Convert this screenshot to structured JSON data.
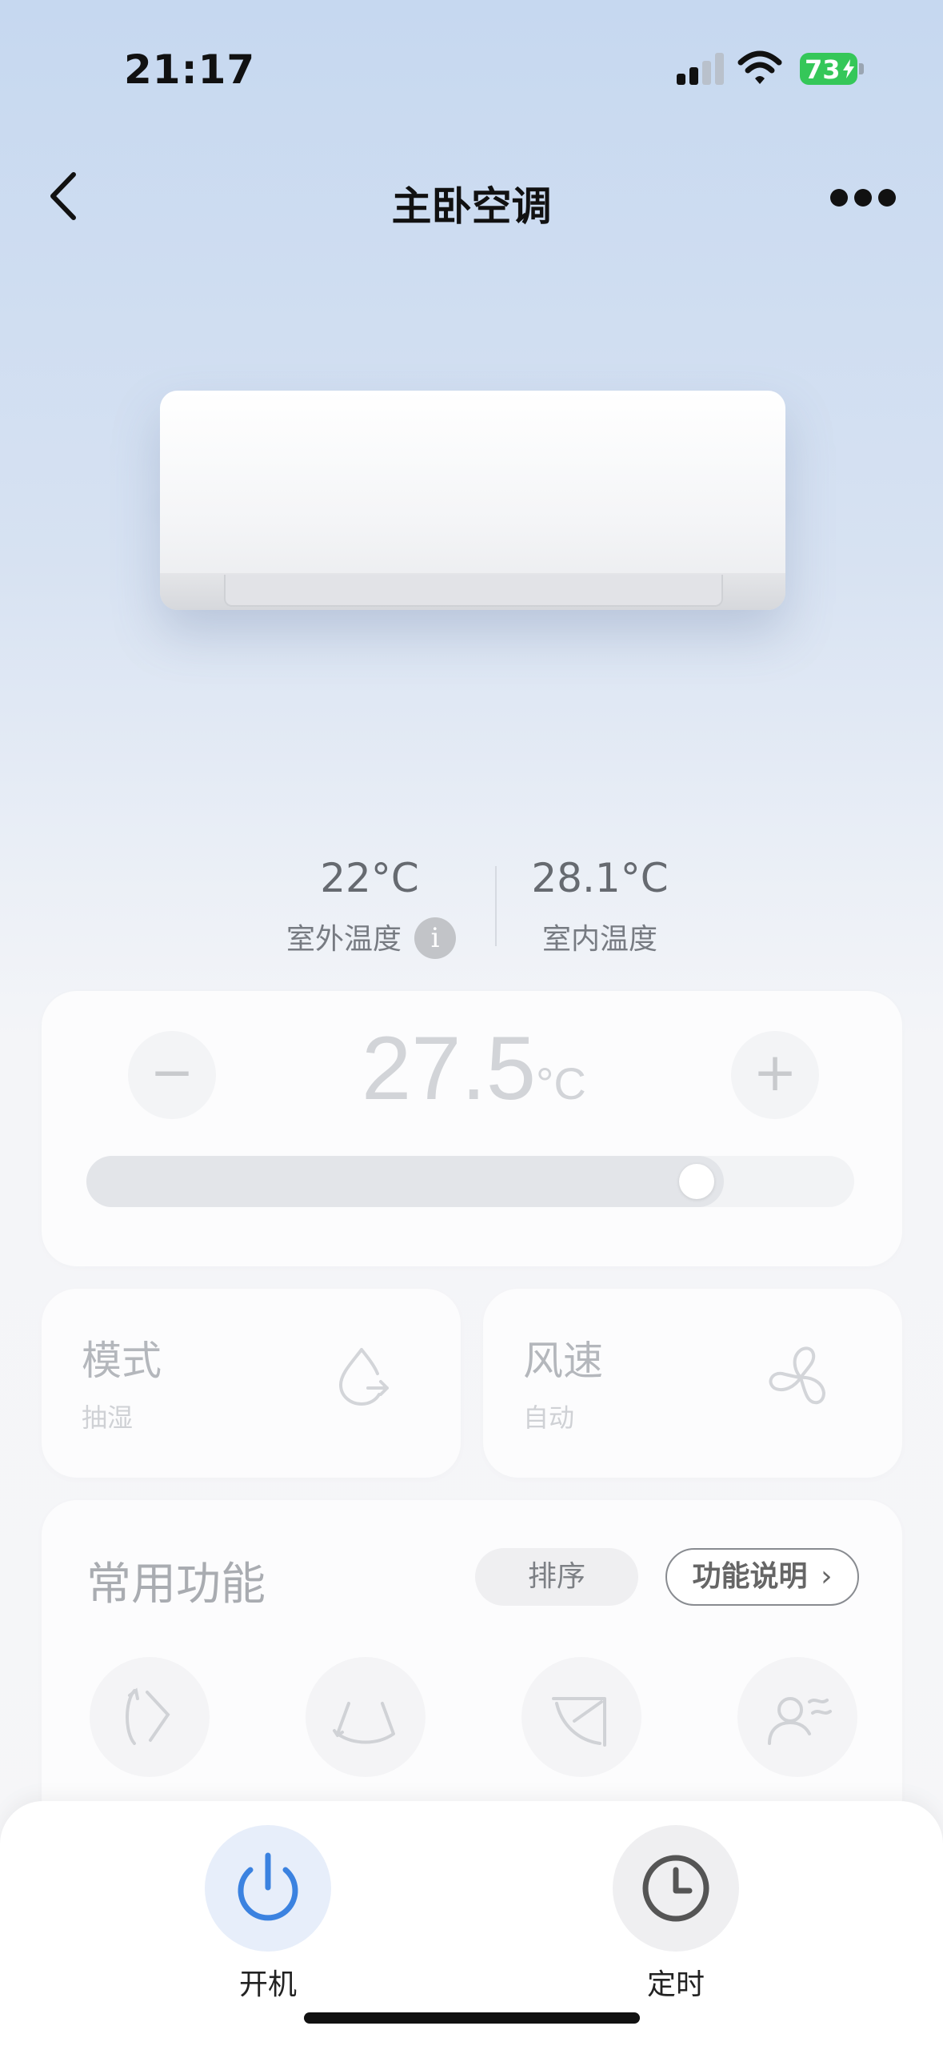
{
  "status_bar": {
    "time": "21:17",
    "battery_level": "73",
    "battery_color": "#35c759"
  },
  "nav": {
    "back_icon": "chevron-left-icon",
    "title": "主卧空调",
    "more_icon": "ellipsis-icon"
  },
  "temps": {
    "outdoor_value": "22°C",
    "outdoor_label": "室外温度",
    "info_icon_glyph": "i",
    "indoor_value": "28.1°C",
    "indoor_label": "室内温度"
  },
  "setpoint": {
    "minus_label": "−",
    "value": "27.5",
    "unit": "°C",
    "plus_label": "+",
    "slider_fraction": 0.83
  },
  "mode_card": {
    "title": "模式",
    "value": "抽湿",
    "icon": "droplet-icon"
  },
  "fan_card": {
    "title": "风速",
    "value": "自动",
    "icon": "fan-icon"
  },
  "functions": {
    "title": "常用功能",
    "sort_label": "排序",
    "desc_label": "功能说明",
    "desc_chevron": "›",
    "items": [
      {
        "icon": "swing-left-right-icon"
      },
      {
        "icon": "swing-up-down-icon"
      },
      {
        "icon": "swing-diagonal-icon"
      },
      {
        "icon": "person-wind-icon"
      }
    ]
  },
  "bottom_bar": {
    "power_label": "开机",
    "power_icon": "power-icon",
    "power_color": "#3b82e0",
    "timer_label": "定时",
    "timer_icon": "clock-icon"
  }
}
